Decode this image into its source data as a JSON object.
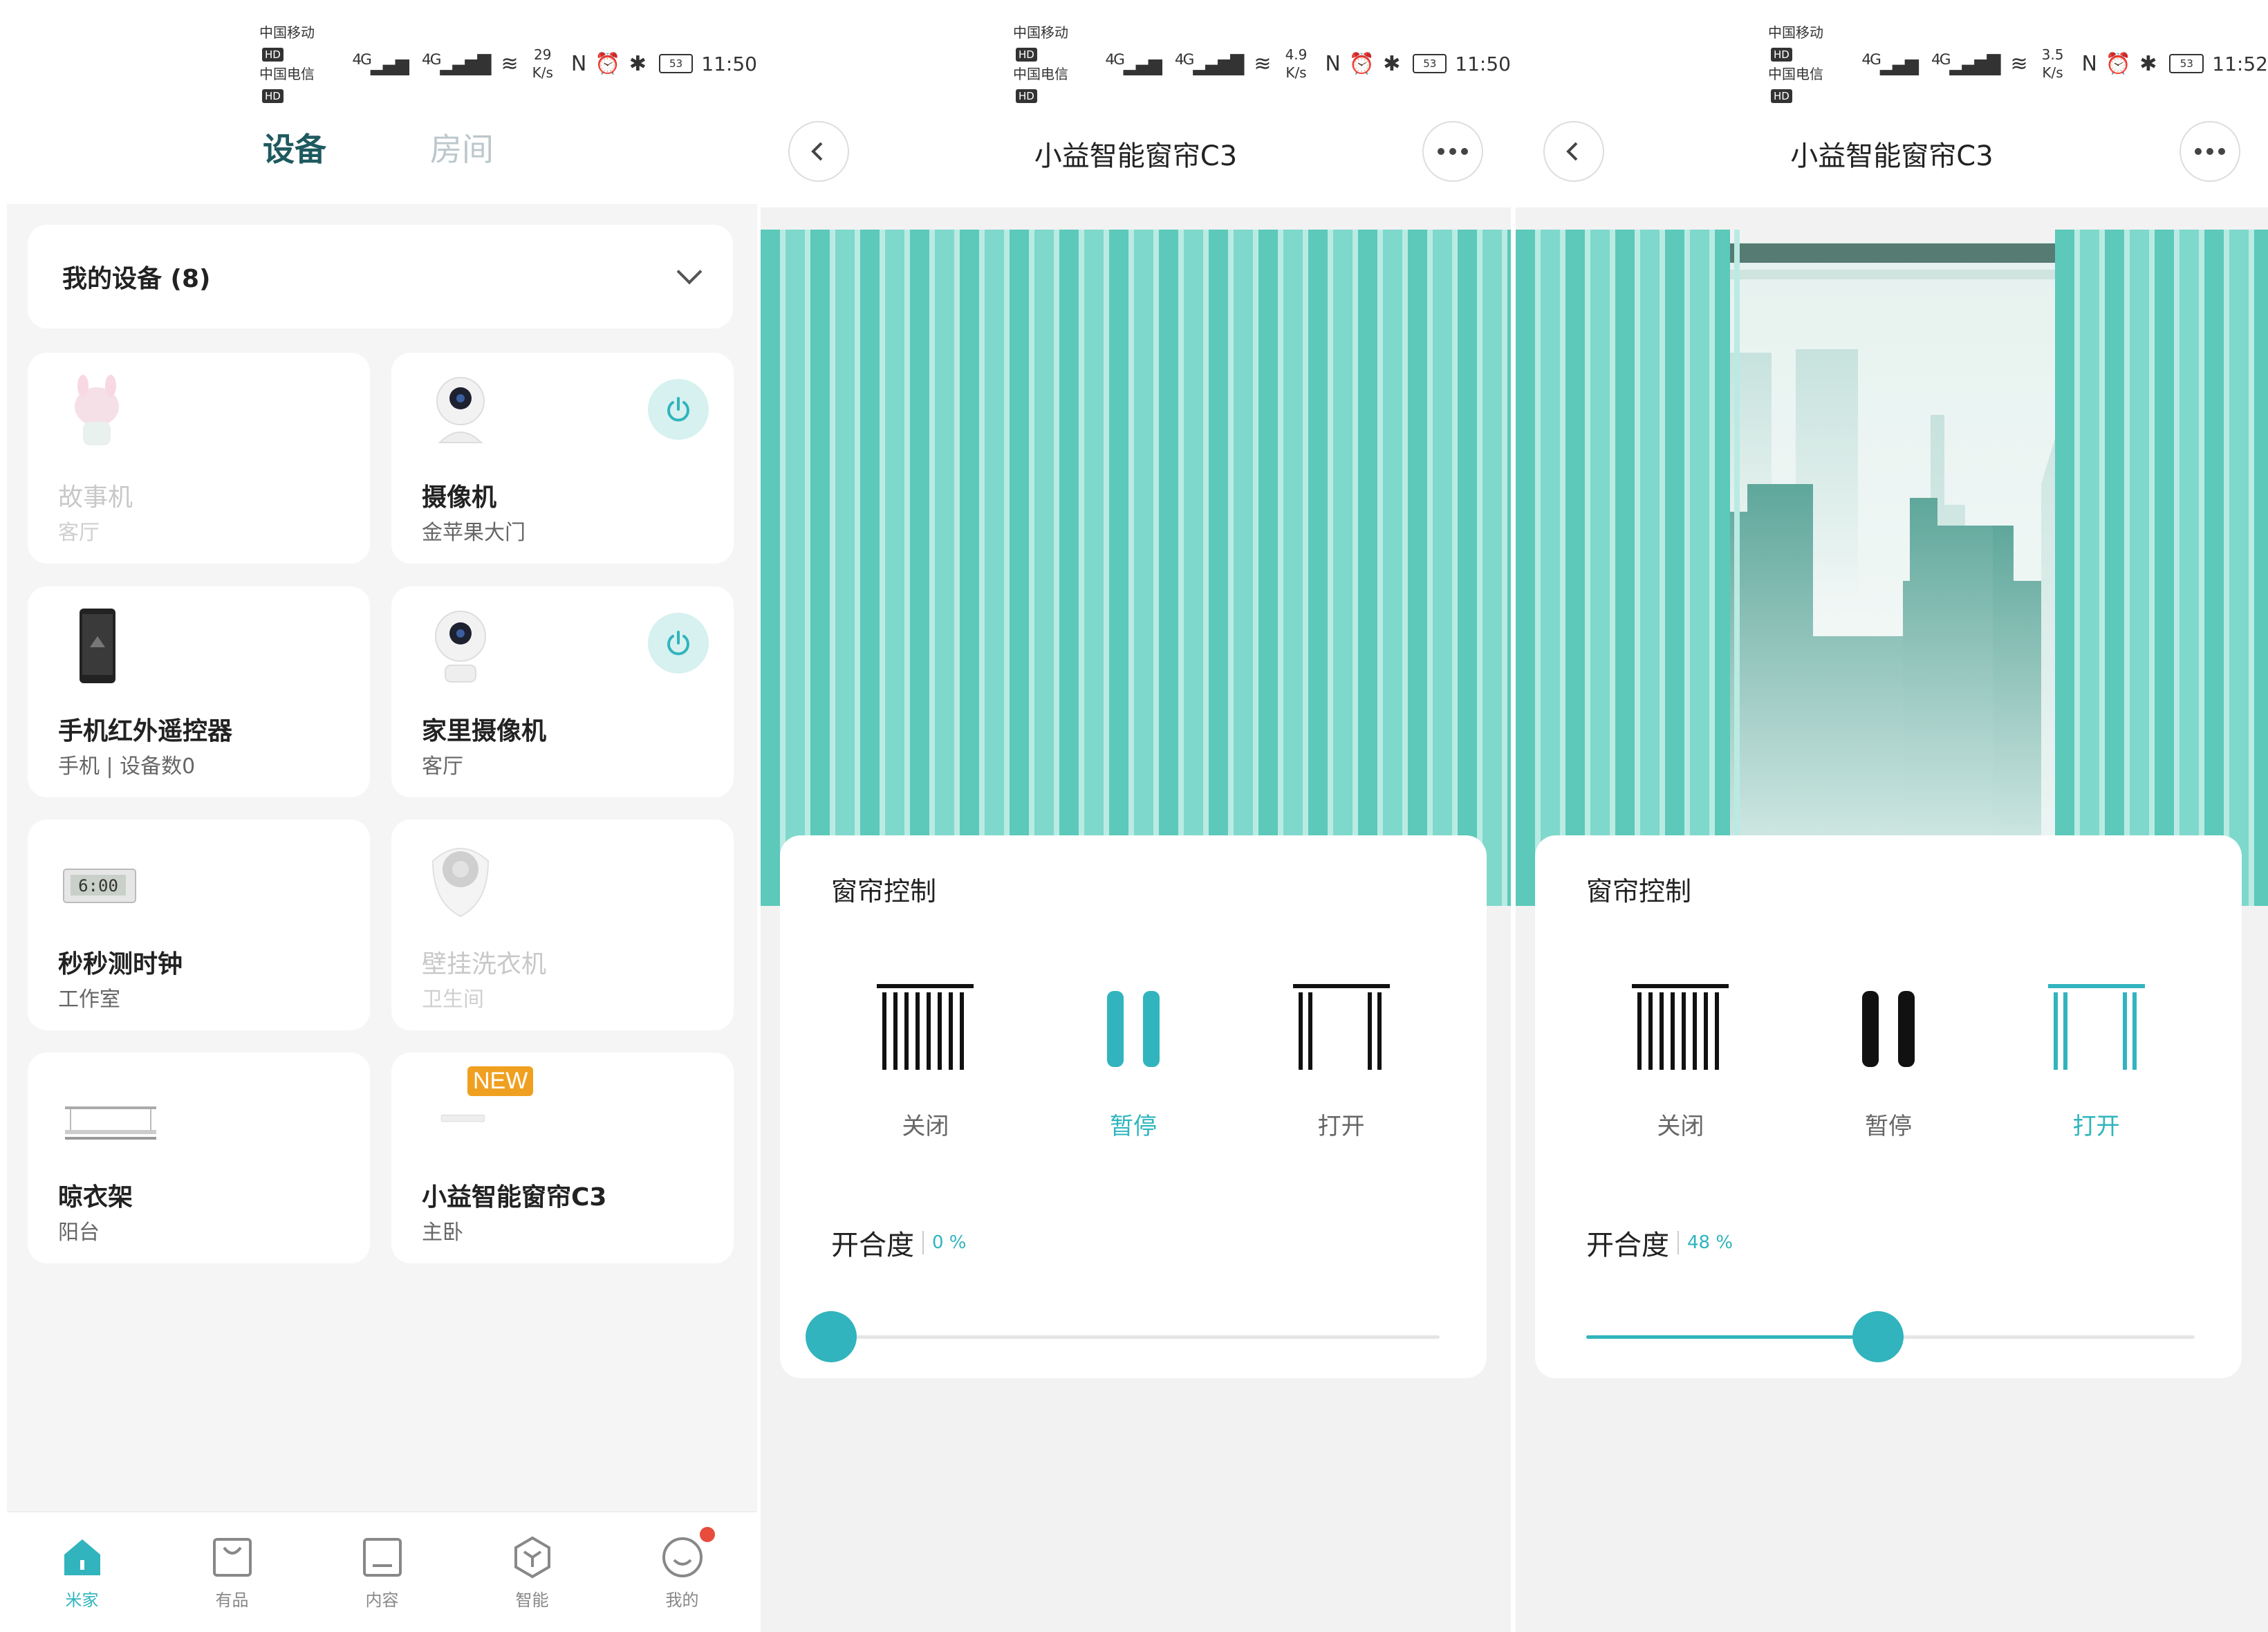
{
  "colors": {
    "accent": "#31b4bd",
    "curtain": "#7fd8cc",
    "curtain_dark": "#5cc9ba",
    "dark_tab": "#1e5a5f",
    "badge": "#f0a020"
  },
  "panel1": {
    "status": {
      "carrier1": "中国移动",
      "carrier2": "中国电信",
      "hd": "HD",
      "net": "4G",
      "speed_val": "29",
      "speed_unit": "K/s",
      "battery": "53",
      "time": "11:50"
    },
    "tabs": {
      "devices": "设备",
      "rooms": "房间"
    },
    "my_devices": "我的设备 (8)",
    "cards": [
      {
        "name": "故事机",
        "room": "客厅",
        "icon": "story-machine-icon",
        "dim": true,
        "power": false
      },
      {
        "name": "摄像机",
        "room": "金苹果大门",
        "icon": "camera-icon",
        "dim": false,
        "power": true
      },
      {
        "name": "手机红外遥控器",
        "room": "手机 | 设备数0",
        "icon": "phone-remote-icon",
        "dim": false,
        "power": false
      },
      {
        "name": "家里摄像机",
        "room": "客厅",
        "icon": "camera-icon",
        "dim": false,
        "power": true
      },
      {
        "name": "秒秒测时钟",
        "room": "工作室",
        "icon": "clock-icon",
        "dim": false,
        "power": false
      },
      {
        "name": "壁挂洗衣机",
        "room": "卫生间",
        "icon": "washer-icon",
        "dim": true,
        "power": false
      },
      {
        "name": "晾衣架",
        "room": "阳台",
        "icon": "drying-rack-icon",
        "dim": false,
        "power": false
      },
      {
        "name": "小益智能窗帘C3",
        "room": "主卧",
        "icon": "curtain-motor-icon",
        "dim": false,
        "power": false,
        "badge": "NEW"
      }
    ],
    "nav": [
      {
        "label": "米家",
        "icon": "home-icon",
        "active": true
      },
      {
        "label": "有品",
        "icon": "bag-icon",
        "active": false
      },
      {
        "label": "内容",
        "icon": "content-icon",
        "active": false
      },
      {
        "label": "智能",
        "icon": "smart-icon",
        "active": false
      },
      {
        "label": "我的",
        "icon": "profile-icon",
        "active": false
      }
    ]
  },
  "panel2": {
    "status": {
      "carrier1": "中国移动",
      "carrier2": "中国电信",
      "hd": "HD",
      "net": "4G",
      "speed_val": "4.9",
      "speed_unit": "K/s",
      "battery": "53",
      "time": "11:50"
    },
    "title": "小益智能窗帘C3",
    "control_title": "窗帘控制",
    "buttons": {
      "close": "关闭",
      "pause": "暂停",
      "open": "打开"
    },
    "active_button": "pause",
    "degree_label": "开合度",
    "degree_value": "0 %",
    "openness": 0
  },
  "panel3": {
    "status": {
      "carrier1": "中国移动",
      "carrier2": "中国电信",
      "hd": "HD",
      "net": "4G",
      "speed_val": "3.5",
      "speed_unit": "K/s",
      "battery": "53",
      "time": "11:52"
    },
    "title": "小益智能窗帘C3",
    "control_title": "窗帘控制",
    "buttons": {
      "close": "关闭",
      "pause": "暂停",
      "open": "打开"
    },
    "active_button": "open",
    "degree_label": "开合度",
    "degree_value": "48 %",
    "openness": 0.48
  }
}
